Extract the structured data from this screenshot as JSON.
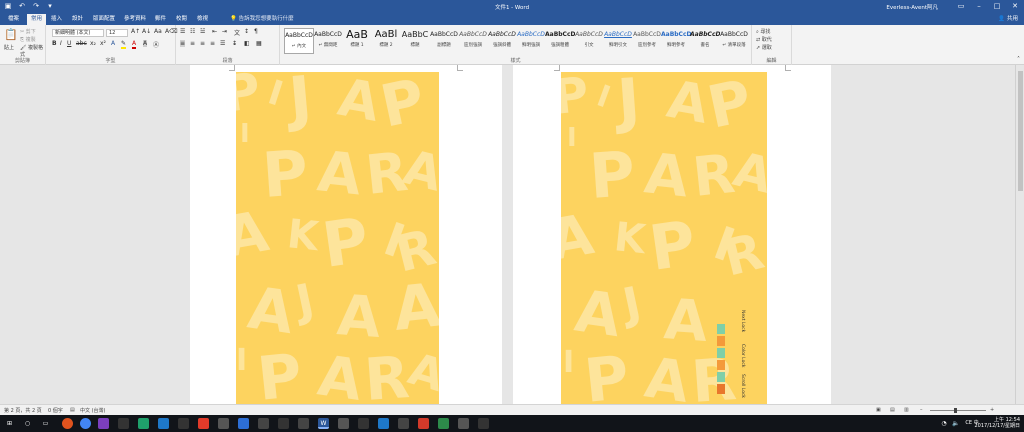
{
  "window": {
    "title": "文件1 - Word",
    "account": "Everless-Avent阿凡"
  },
  "tabs": [
    "檔案",
    "常用",
    "插入",
    "設計",
    "版面配置",
    "參考資料",
    "郵件",
    "校閱",
    "檢視"
  ],
  "tell_me": "告訴我您想要執行什麼",
  "share": "共用",
  "ribbon": {
    "clipboard": {
      "paste": "貼上",
      "cut": "剪下",
      "copy": "複製",
      "format_painter": "複製格式",
      "label": "剪貼簿"
    },
    "font": {
      "name": "新細明體 (本文)",
      "size": "12",
      "label": "字型"
    },
    "paragraph": {
      "label": "段落"
    },
    "styles": {
      "label": "樣式",
      "items": [
        {
          "preview": "AaBbCcD",
          "name": "↵ 內文"
        },
        {
          "preview": "AaBbCcD",
          "name": "↵ 無間距"
        },
        {
          "preview": "AaB",
          "name": "標題 1"
        },
        {
          "preview": "AaBl",
          "name": "標題 2"
        },
        {
          "preview": "AaBbC",
          "name": "標題"
        },
        {
          "preview": "AaBbCcD",
          "name": "副標題"
        },
        {
          "preview": "AaBbCcD",
          "name": "區別強調"
        },
        {
          "preview": "AaBbCcD",
          "name": "強調斜體"
        },
        {
          "preview": "AaBbCcD",
          "name": "鮮明強調"
        },
        {
          "preview": "AaBbCcD",
          "name": "強調粗體"
        },
        {
          "preview": "AaBbCcD",
          "name": "引文"
        },
        {
          "preview": "AaBbCcD",
          "name": "鮮明引文"
        },
        {
          "preview": "AaBbCcD",
          "name": "區別參考"
        },
        {
          "preview": "AaBbCcD",
          "name": "鮮明參考"
        },
        {
          "preview": "AaBbCcD",
          "name": "書名"
        },
        {
          "preview": "AaBbCcD",
          "name": "↵ 清單段落"
        }
      ]
    },
    "editing": {
      "find": "尋找",
      "replace": "取代",
      "select": "選取",
      "label": "編輯"
    }
  },
  "statusbar": {
    "page": "第 2 頁，共 2 頁",
    "words": "0 個字",
    "language": "中文 (台灣)"
  },
  "tray": {
    "time": "上午 12:54",
    "date": "2017/12/17/星期日",
    "ime": "CE 中"
  },
  "sidebar_labels": [
    "Next Lock",
    "Color Lock",
    "Scroll Lock"
  ],
  "colors": {
    "word_blue": "#2b579a",
    "page_bg": "#fdd35f",
    "pattern": "#fde49b"
  }
}
